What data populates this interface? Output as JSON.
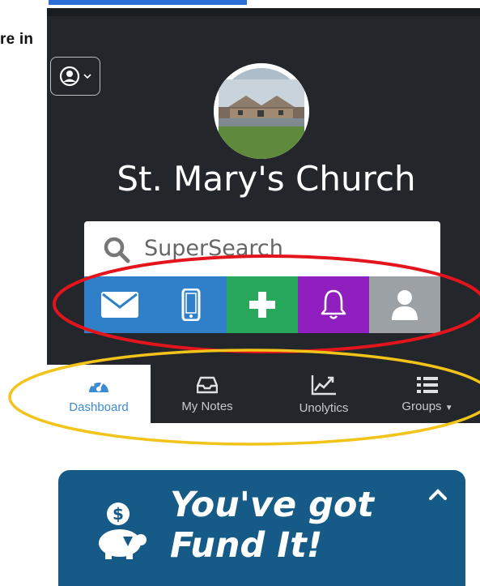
{
  "cropped_text": "re in",
  "profile": {
    "name": "St. Mary's Church",
    "image_icon": "church-photo"
  },
  "search": {
    "placeholder": "SuperSearch"
  },
  "actions": [
    {
      "name": "email",
      "icon": "envelope-icon",
      "color": "#2f80c9"
    },
    {
      "name": "mobile",
      "icon": "phone-icon",
      "color": "#2f80c9"
    },
    {
      "name": "add",
      "icon": "plus-icon",
      "color": "#28a85a"
    },
    {
      "name": "alerts",
      "icon": "bell-icon",
      "color": "#8f1fbf"
    },
    {
      "name": "person",
      "icon": "user-icon",
      "color": "#9ca1a6"
    }
  ],
  "tabs": [
    {
      "label": "Dashboard",
      "icon": "dashboard-gauge-icon",
      "active": true
    },
    {
      "label": "My Notes",
      "icon": "inbox-tray-icon",
      "active": false
    },
    {
      "label": "Unolytics",
      "icon": "chart-line-icon",
      "active": false
    },
    {
      "label": "Groups",
      "icon": "list-icon",
      "active": false
    }
  ],
  "fund_card": {
    "title_line1": "You've got",
    "title_line2": "Fund It!",
    "icon": "piggy-bank-dollar-icon"
  },
  "colors": {
    "panel_bg": "#23272b",
    "accent_blue": "#3d8bd1",
    "card_bg": "#165b87",
    "annotation_red": "#e3141b",
    "annotation_yellow": "#f2c318"
  }
}
